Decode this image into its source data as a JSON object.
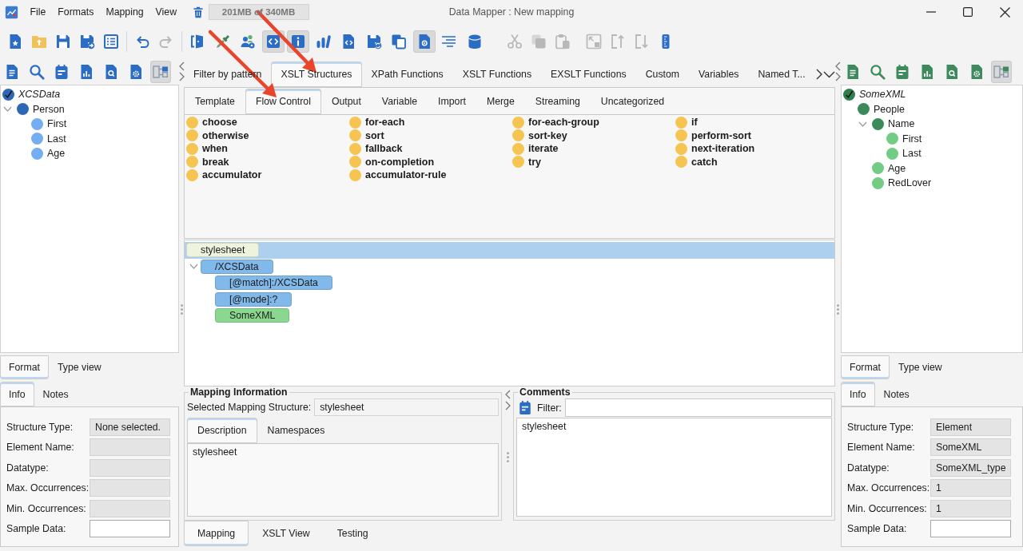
{
  "window": {
    "title": "Data Mapper : New mapping"
  },
  "menu": [
    "File",
    "Formats",
    "Mapping",
    "View"
  ],
  "memory": "201MB of 340MB",
  "toolbar": [
    [
      {
        "selected": false,
        "disabled": false
      },
      {
        "selected": false,
        "disabled": false
      },
      {
        "selected": false,
        "disabled": false
      },
      {
        "selected": false,
        "disabled": false
      },
      {
        "selected": false,
        "disabled": false
      }
    ],
    [
      {
        "selected": false,
        "disabled": false
      },
      {
        "selected": false,
        "disabled": true
      }
    ],
    [
      {
        "selected": false,
        "disabled": false
      },
      {
        "selected": false,
        "disabled": false
      },
      {
        "selected": false,
        "disabled": false
      },
      {
        "selected": true,
        "disabled": false
      },
      {
        "selected": true,
        "disabled": false
      },
      {
        "selected": false,
        "disabled": false
      },
      {
        "selected": false,
        "disabled": false
      },
      {
        "selected": false,
        "disabled": false
      },
      {
        "selected": false,
        "disabled": false
      },
      {
        "selected": true,
        "disabled": false
      },
      {
        "selected": false,
        "disabled": false
      },
      {
        "selected": false,
        "disabled": false
      }
    ],
    [
      {
        "selected": false,
        "disabled": true
      },
      {
        "selected": false,
        "disabled": true
      },
      {
        "selected": false,
        "disabled": true
      }
    ],
    [
      {
        "selected": false,
        "disabled": true
      },
      {
        "selected": false,
        "disabled": true
      },
      {
        "selected": false,
        "disabled": true
      },
      {
        "selected": false,
        "disabled": false
      }
    ]
  ],
  "source_panel": {
    "toolbar": [
      {
        "selected": false
      },
      {
        "selected": false
      },
      {
        "selected": false
      },
      {
        "selected": false
      },
      {
        "selected": false
      },
      {
        "selected": false
      },
      {
        "selected": true
      }
    ],
    "tree": [
      {
        "label": "XCSData",
        "kind": "root",
        "color": "#2d68b4",
        "children": [
          {
            "label": "Person",
            "kind": "element",
            "color": "#2d68b4",
            "expanded": true,
            "children": [
              {
                "label": "First",
                "kind": "element",
                "color": "#74aef0"
              },
              {
                "label": "Last",
                "kind": "element",
                "color": "#74aef0"
              },
              {
                "label": "Age",
                "kind": "element",
                "color": "#74aef0"
              }
            ]
          }
        ]
      }
    ],
    "view_tabs": [
      {
        "label": "Format",
        "selected": true
      },
      {
        "label": "Type view",
        "selected": false
      }
    ],
    "info_tabs": [
      {
        "label": "Info",
        "selected": true
      },
      {
        "label": "Notes",
        "selected": false
      }
    ],
    "fields": [
      {
        "label": "Structure Type:",
        "value": "None selected.",
        "editable": false
      },
      {
        "label": "Element Name:",
        "editable": false
      },
      {
        "label": "Datatype:",
        "editable": false
      },
      {
        "label": "Max. Occurrences:",
        "editable": false
      },
      {
        "label": "Min. Occurrences:",
        "editable": false
      },
      {
        "label": "Sample Data:",
        "editable": true
      }
    ]
  },
  "palette": {
    "category_tabs": [
      {
        "label": "Filter by pattern",
        "selected": false
      },
      {
        "label": "XSLT Structures",
        "selected": true
      },
      {
        "label": "XPath Functions",
        "selected": false
      },
      {
        "label": "XSLT Functions",
        "selected": false
      },
      {
        "label": "EXSLT Functions",
        "selected": false
      },
      {
        "label": "Custom",
        "selected": false
      },
      {
        "label": "Variables",
        "selected": false
      },
      {
        "label": "Named T...",
        "selected": false
      }
    ],
    "group_tabs": [
      {
        "label": "Template",
        "selected": false
      },
      {
        "label": "Flow Control",
        "selected": true
      },
      {
        "label": "Output",
        "selected": false
      },
      {
        "label": "Variable",
        "selected": false
      },
      {
        "label": "Import",
        "selected": false
      },
      {
        "label": "Merge",
        "selected": false
      },
      {
        "label": "Streaming",
        "selected": false
      },
      {
        "label": "Uncategorized",
        "selected": false
      }
    ],
    "items": [
      "choose",
      "for-each",
      "for-each-group",
      "if",
      "otherwise",
      "sort",
      "sort-key",
      "perform-sort",
      "when",
      "fallback",
      "iterate",
      "next-iteration",
      "break",
      "on-completion",
      "try",
      "catch",
      "accumulator",
      "accumulator-rule"
    ]
  },
  "mapping_tree": [
    {
      "label": "stylesheet",
      "color": "#eef3dd",
      "selected": true,
      "children": [
        {
          "label": "/XCSData",
          "color": "#80b9ea",
          "selected": false,
          "expanded": true,
          "children": [
            {
              "label": "[@match]:/XCSData",
              "color": "#80b9ea",
              "selected": false
            },
            {
              "label": "[@mode]:?",
              "color": "#80b9ea",
              "selected": false
            },
            {
              "label": "SomeXML",
              "color": "#8ad890",
              "selected": false
            }
          ]
        }
      ]
    }
  ],
  "mapping_information": {
    "title": "Mapping Information",
    "structure_label": "Selected Mapping Structure:",
    "structure_value": "stylesheet",
    "tabs": [
      {
        "label": "Description",
        "selected": true
      },
      {
        "label": "Namespaces",
        "selected": false
      }
    ],
    "description": "stylesheet"
  },
  "comments": {
    "title": "Comments",
    "filter_label": "Filter:",
    "text": "stylesheet"
  },
  "bottom_tabs": [
    {
      "label": "Mapping",
      "selected": true
    },
    {
      "label": "XSLT View",
      "selected": false
    },
    {
      "label": "Testing",
      "selected": false
    }
  ],
  "target_panel": {
    "toolbar": [
      {
        "selected": false
      },
      {
        "selected": false
      },
      {
        "selected": false
      },
      {
        "selected": false
      },
      {
        "selected": false
      },
      {
        "selected": false
      },
      {
        "selected": true
      }
    ],
    "tree": [
      {
        "label": "SomeXML",
        "kind": "root",
        "color": "#2f7d4c",
        "children": [
          {
            "label": "People",
            "kind": "element",
            "color": "#3a8a5a",
            "children": [
              {
                "label": "Name",
                "kind": "element",
                "color": "#3a8a5a",
                "expanded": true,
                "children": [
                  {
                    "label": "First",
                    "kind": "element",
                    "color": "#73cc84"
                  },
                  {
                    "label": "Last",
                    "kind": "element",
                    "color": "#73cc84"
                  }
                ]
              },
              {
                "label": "Age",
                "kind": "element",
                "color": "#73cc84"
              },
              {
                "label": "RedLover",
                "kind": "element",
                "color": "#73cc84"
              }
            ]
          }
        ]
      }
    ],
    "view_tabs": [
      {
        "label": "Format",
        "selected": true
      },
      {
        "label": "Type view",
        "selected": false
      }
    ],
    "info_tabs": [
      {
        "label": "Info",
        "selected": true
      },
      {
        "label": "Notes",
        "selected": false
      }
    ],
    "fields": [
      {
        "label": "Structure Type:",
        "value": "Element",
        "editable": false
      },
      {
        "label": "Element Name:",
        "value": "SomeXML",
        "editable": false
      },
      {
        "label": "Datatype:",
        "value": "SomeXML_type",
        "editable": false
      },
      {
        "label": "Max. Occurrences:",
        "value": "1",
        "editable": false
      },
      {
        "label": "Min. Occurrences:",
        "value": "1",
        "editable": false
      },
      {
        "label": "Sample Data:",
        "editable": true
      }
    ]
  }
}
